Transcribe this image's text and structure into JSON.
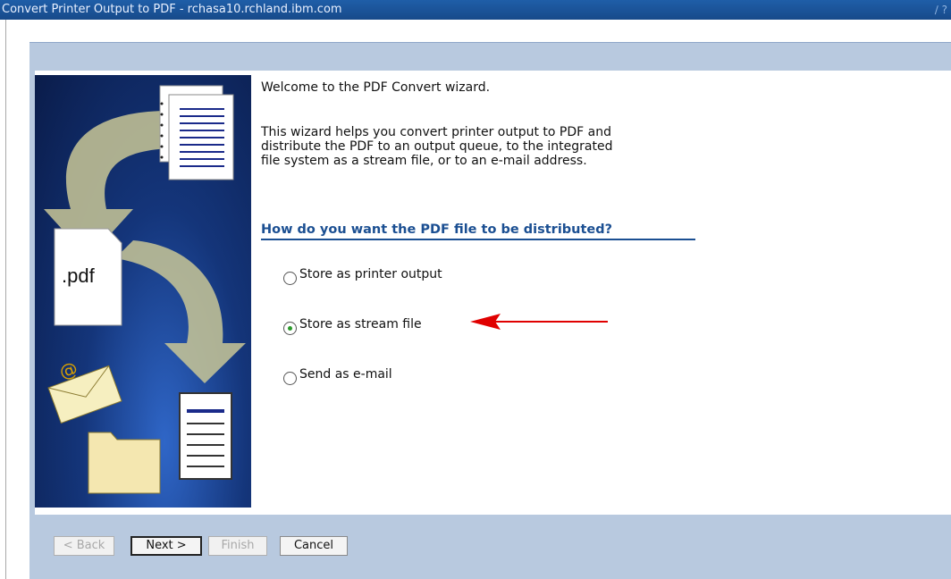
{
  "window": {
    "title": "Convert Printer Output to PDF - rchasa10.rchland.ibm.com",
    "corner_icons": "∕ ?"
  },
  "wizard": {
    "welcome": "Welcome to the PDF Convert wizard.",
    "intro": "This wizard helps you convert printer output to PDF and\ndistribute the PDF to an output queue, to the integrated\nfile system as a stream file, or to an e-mail address.",
    "question": "How do you want the PDF file to be distributed?",
    "options": [
      {
        "label": "Store as printer output",
        "selected": false
      },
      {
        "label": "Store as stream file",
        "selected": true
      },
      {
        "label": "Send as e-mail",
        "selected": false
      }
    ],
    "graphic_text": ".pdf"
  },
  "buttons": {
    "back": "< Back",
    "next": "Next >",
    "finish": "Finish",
    "cancel": "Cancel"
  },
  "colors": {
    "title_bar": "#1f5ea8",
    "band": "#b8c9df",
    "heading": "#1b4f92",
    "annotation_arrow": "#e00000"
  }
}
